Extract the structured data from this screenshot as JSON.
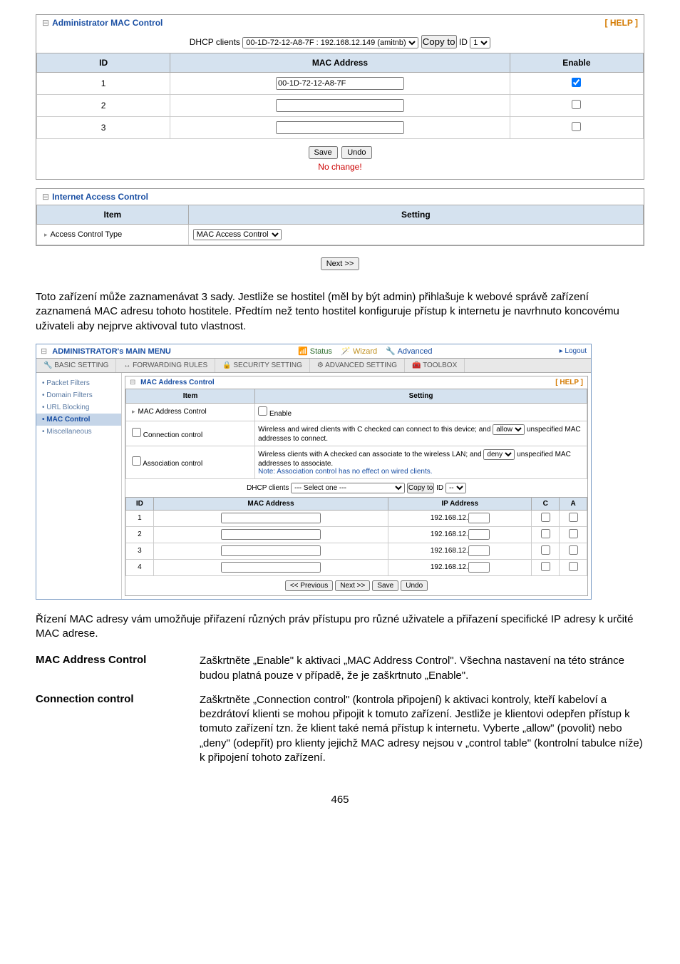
{
  "panel1": {
    "title": "Administrator MAC Control",
    "help": "[ HELP ]",
    "dhcp_label": "DHCP clients",
    "dhcp_value": "00-1D-72-12-A8-7F : 192.168.12.149 (amitnb)",
    "copy_btn": "Copy to",
    "id_label": "ID",
    "id_value": "1",
    "headers": {
      "id": "ID",
      "mac": "MAC Address",
      "enable": "Enable"
    },
    "rows": [
      {
        "id": "1",
        "mac": "00-1D-72-12-A8-7F",
        "checked": true
      },
      {
        "id": "2",
        "mac": "",
        "checked": false
      },
      {
        "id": "3",
        "mac": "",
        "checked": false
      }
    ],
    "save_btn": "Save",
    "undo_btn": "Undo",
    "no_change": "No change!"
  },
  "panel2": {
    "title": "Internet Access Control",
    "headers": {
      "item": "Item",
      "setting": "Setting"
    },
    "row_label": "Access Control Type",
    "row_value": "MAC Access Control",
    "next_btn": "Next >>"
  },
  "para1": "Toto zařízení může zaznamenávat 3 sady. Jestliže se hostitel (měl by být admin) přihlašuje k webové správě zařízení zaznamená MAC adresu tohoto hostitele. Předtím než tento hostitel konfiguruje přístup k internetu je navrhnuto koncovému uživateli aby nejprve aktivoval tuto vlastnost.",
  "ss2": {
    "main_menu": "ADMINISTRATOR's MAIN MENU",
    "status": "Status",
    "wizard": "Wizard",
    "advanced": "Advanced",
    "logout": "▸ Logout",
    "tabs": {
      "basic": "BASIC SETTING",
      "fwd": "FORWARDING RULES",
      "sec": "SECURITY SETTING",
      "adv": "ADVANCED SETTING",
      "tool": "TOOLBOX"
    },
    "sidebar": {
      "packet": "Packet Filters",
      "domain": "Domain Filters",
      "url": "URL Blocking",
      "mac": "MAC Control",
      "misc": "Miscellaneous"
    },
    "panel_title": "MAC Address Control",
    "panel_help": "[ HELP ]",
    "th_item": "Item",
    "th_setting": "Setting",
    "r1_lbl": "MAC Address Control",
    "r1_val": "Enable",
    "r2_lbl": "Connection control",
    "r2_txt1": "Wireless and wired clients with C checked can connect to this device; and",
    "r2_sel": "allow",
    "r2_txt2": "unspecified MAC addresses to connect.",
    "r3_lbl": "Association control",
    "r3_txt1": "Wireless clients with A checked can associate to the wireless LAN; and",
    "r3_sel": "deny",
    "r3_txt2": "unspecified MAC addresses to associate.",
    "r3_note": "Note: Association control has no effect on wired clients.",
    "dhcp_lbl": "DHCP clients",
    "dhcp_sel": "--- Select one ---",
    "dhcp_copy": "Copy to",
    "dhcp_id": "ID",
    "dhcp_idv": "--",
    "grid_th": {
      "id": "ID",
      "mac": "MAC Address",
      "ip": "IP Address",
      "c": "C",
      "a": "A"
    },
    "grid_rows": [
      {
        "id": "1",
        "ip_prefix": "192.168.12."
      },
      {
        "id": "2",
        "ip_prefix": "192.168.12."
      },
      {
        "id": "3",
        "ip_prefix": "192.168.12."
      },
      {
        "id": "4",
        "ip_prefix": "192.168.12."
      }
    ],
    "btns": {
      "prev": "<< Previous",
      "next": "Next >>",
      "save": "Save",
      "undo": "Undo"
    }
  },
  "para2": "Řízení MAC adresy vám umožňuje přiřazení různých práv přístupu pro různé uživatele a přiřazení specifické IP adresy k určité MAC adrese.",
  "defs": [
    {
      "term": "MAC Address Control",
      "desc": "Zaškrtněte „Enable\" k aktivaci „MAC Address Control\". Všechna nastavení na této stránce budou platná pouze v případě, že je zaškrtnuto „Enable\"."
    },
    {
      "term": "Connection control",
      "desc": "Zaškrtněte „Connection control\" (kontrola připojení) k aktivaci kontroly, kteří kabeloví a bezdrátoví klienti se mohou připojit k tomuto zařízení. Jestliže je klientovi odepřen přístup k tomuto zařízení tzn. že klient také nemá přístup k internetu. Vyberte „allow\" (povolit) nebo „deny\" (odepřít) pro klienty jejichž MAC adresy nejsou v „control table\" (kontrolní tabulce níže) k připojení tohoto zařízení."
    }
  ],
  "page_num": "465"
}
